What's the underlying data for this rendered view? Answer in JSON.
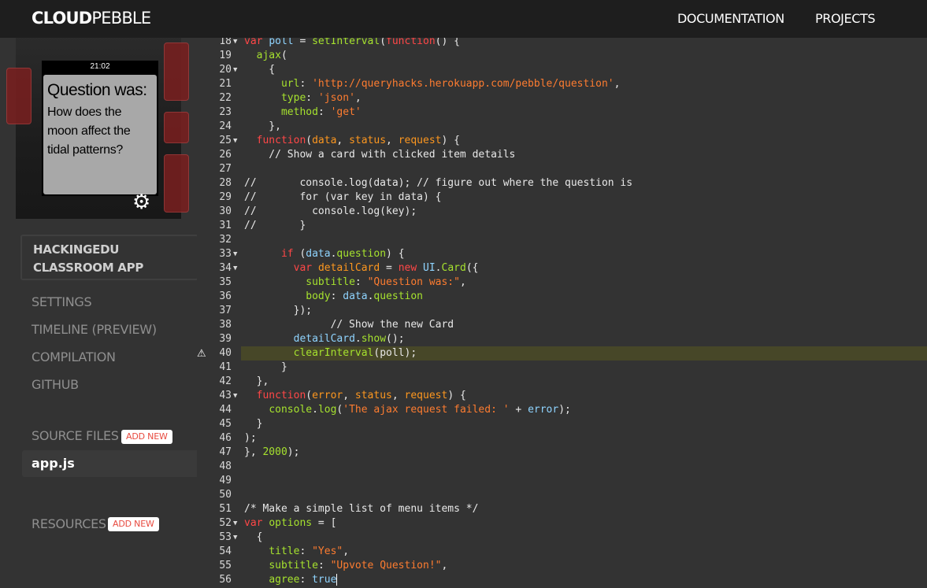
{
  "app": {
    "logo_bold": "CLOUD",
    "logo_rest": "PEBBLE",
    "nav": {
      "documentation": "DOCUMENTATION",
      "projects": "PROJECTS"
    }
  },
  "emulator": {
    "time": "21:02",
    "card_subtitle": "Question was:",
    "card_body": "How does the moon affect the tidal patterns?",
    "gear_icon": "gear-icon"
  },
  "sidebar": {
    "project_name": "HACKINGEDU CLASSROOM APP",
    "items": [
      {
        "label": "SETTINGS"
      },
      {
        "label": "TIMELINE (PREVIEW)"
      },
      {
        "label": "COMPILATION"
      },
      {
        "label": "GITHUB"
      }
    ],
    "source_files_label": "SOURCE FILES",
    "add_new_label": "ADD NEW",
    "files": [
      {
        "name": "app.js"
      }
    ],
    "resources_label": "RESOURCES",
    "resources_add_label": "ADD NEW"
  },
  "editor": {
    "warning_icon": "warning-icon",
    "active_line": 40,
    "lines": [
      {
        "n": "18",
        "fold": true
      },
      {
        "n": "19",
        "fold": false
      },
      {
        "n": "20",
        "fold": true
      },
      {
        "n": "21",
        "fold": false
      },
      {
        "n": "22",
        "fold": false
      },
      {
        "n": "23",
        "fold": false
      },
      {
        "n": "24",
        "fold": false
      },
      {
        "n": "25",
        "fold": true
      },
      {
        "n": "26",
        "fold": false
      },
      {
        "n": "27",
        "fold": false
      },
      {
        "n": "28",
        "fold": false
      },
      {
        "n": "29",
        "fold": false
      },
      {
        "n": "30",
        "fold": false
      },
      {
        "n": "31",
        "fold": false
      },
      {
        "n": "32",
        "fold": false
      },
      {
        "n": "33",
        "fold": true
      },
      {
        "n": "34",
        "fold": true
      },
      {
        "n": "35",
        "fold": false
      },
      {
        "n": "36",
        "fold": false
      },
      {
        "n": "37",
        "fold": false
      },
      {
        "n": "38",
        "fold": false
      },
      {
        "n": "39",
        "fold": false
      },
      {
        "n": "40",
        "fold": false
      },
      {
        "n": "41",
        "fold": false
      },
      {
        "n": "42",
        "fold": false
      },
      {
        "n": "43",
        "fold": true
      },
      {
        "n": "44",
        "fold": false
      },
      {
        "n": "45",
        "fold": false
      },
      {
        "n": "46",
        "fold": false
      },
      {
        "n": "47",
        "fold": false
      },
      {
        "n": "48",
        "fold": false
      },
      {
        "n": "49",
        "fold": false
      },
      {
        "n": "50",
        "fold": false
      },
      {
        "n": "51",
        "fold": false
      },
      {
        "n": "52",
        "fold": true
      },
      {
        "n": "53",
        "fold": true
      },
      {
        "n": "54",
        "fold": false
      },
      {
        "n": "55",
        "fold": false
      },
      {
        "n": "56",
        "fold": false
      }
    ],
    "code": [
      [
        [
          "k",
          "var"
        ],
        [
          "c",
          " "
        ],
        [
          "v",
          "poll"
        ],
        [
          "c",
          " = "
        ],
        [
          "n",
          "setInterval"
        ],
        [
          "c",
          "("
        ],
        [
          "k",
          "function"
        ],
        [
          "c",
          "() {"
        ]
      ],
      [
        [
          "c",
          "  "
        ],
        [
          "n",
          "ajax"
        ],
        [
          "c",
          "("
        ]
      ],
      [
        [
          "c",
          "    {"
        ]
      ],
      [
        [
          "c",
          "      "
        ],
        [
          "g",
          "url"
        ],
        [
          "c",
          ": "
        ],
        [
          "s",
          "'http://queryhacks.herokuapp.com/pebble/question'"
        ],
        [
          "c",
          ","
        ]
      ],
      [
        [
          "c",
          "      "
        ],
        [
          "g",
          "type"
        ],
        [
          "c",
          ": "
        ],
        [
          "s",
          "'json'"
        ],
        [
          "c",
          ","
        ]
      ],
      [
        [
          "c",
          "      "
        ],
        [
          "g",
          "method"
        ],
        [
          "c",
          ": "
        ],
        [
          "s",
          "'get'"
        ]
      ],
      [
        [
          "c",
          "    },"
        ]
      ],
      [
        [
          "c",
          "  "
        ],
        [
          "k",
          "function"
        ],
        [
          "c",
          "("
        ],
        [
          "f",
          "data"
        ],
        [
          "c",
          ", "
        ],
        [
          "f",
          "status"
        ],
        [
          "c",
          ", "
        ],
        [
          "f",
          "request"
        ],
        [
          "c",
          ") {"
        ]
      ],
      [
        [
          "c",
          "    // Show a card with clicked item details"
        ]
      ],
      [
        [
          "c",
          ""
        ]
      ],
      [
        [
          "c",
          "//       console.log(data); // figure out where the question is"
        ]
      ],
      [
        [
          "c",
          "//       for (var key in data) {"
        ]
      ],
      [
        [
          "c",
          "//         console.log(key);"
        ]
      ],
      [
        [
          "c",
          "//       }"
        ]
      ],
      [
        [
          "c",
          ""
        ]
      ],
      [
        [
          "c",
          "      "
        ],
        [
          "k",
          "if"
        ],
        [
          "c",
          " ("
        ],
        [
          "v",
          "data"
        ],
        [
          "c",
          "."
        ],
        [
          "g",
          "question"
        ],
        [
          "c",
          ") {"
        ]
      ],
      [
        [
          "c",
          "        "
        ],
        [
          "k",
          "var"
        ],
        [
          "c",
          " "
        ],
        [
          "f",
          "detailCard"
        ],
        [
          "c",
          " = "
        ],
        [
          "k",
          "new"
        ],
        [
          "c",
          " "
        ],
        [
          "v",
          "UI"
        ],
        [
          "c",
          "."
        ],
        [
          "n",
          "Card"
        ],
        [
          "c",
          "({"
        ]
      ],
      [
        [
          "c",
          "          "
        ],
        [
          "g",
          "subtitle"
        ],
        [
          "c",
          ": "
        ],
        [
          "s",
          "\"Question was:\""
        ],
        [
          "c",
          ","
        ]
      ],
      [
        [
          "c",
          "          "
        ],
        [
          "g",
          "body"
        ],
        [
          "c",
          ": "
        ],
        [
          "v",
          "data"
        ],
        [
          "c",
          "."
        ],
        [
          "g",
          "question"
        ]
      ],
      [
        [
          "c",
          "        });"
        ]
      ],
      [
        [
          "c",
          "              // Show the new Card"
        ]
      ],
      [
        [
          "c",
          "        "
        ],
        [
          "v",
          "detailCard"
        ],
        [
          "c",
          "."
        ],
        [
          "n",
          "show"
        ],
        [
          "c",
          "();"
        ]
      ],
      [
        [
          "c",
          "        "
        ],
        [
          "n",
          "clearInterval"
        ],
        [
          "c",
          "(poll);"
        ]
      ],
      [
        [
          "c",
          "      }"
        ]
      ],
      [
        [
          "c",
          "  },"
        ]
      ],
      [
        [
          "c",
          "  "
        ],
        [
          "k",
          "function"
        ],
        [
          "c",
          "("
        ],
        [
          "f",
          "error"
        ],
        [
          "c",
          ", "
        ],
        [
          "f",
          "status"
        ],
        [
          "c",
          ", "
        ],
        [
          "f",
          "request"
        ],
        [
          "c",
          ") {"
        ]
      ],
      [
        [
          "c",
          "    "
        ],
        [
          "g",
          "console"
        ],
        [
          "c",
          "."
        ],
        [
          "g",
          "log"
        ],
        [
          "c",
          "("
        ],
        [
          "s",
          "'The ajax request failed: '"
        ],
        [
          "c",
          " + "
        ],
        [
          "v",
          "error"
        ],
        [
          "c",
          ");"
        ]
      ],
      [
        [
          "c",
          "  }"
        ]
      ],
      [
        [
          "c",
          ");"
        ]
      ],
      [
        [
          "c",
          "}, "
        ],
        [
          "g",
          "2000"
        ],
        [
          "c",
          ");"
        ]
      ],
      [
        [
          "c",
          ""
        ]
      ],
      [
        [
          "c",
          ""
        ]
      ],
      [
        [
          "c",
          ""
        ]
      ],
      [
        [
          "c",
          "/* Make a simple list of menu items */"
        ]
      ],
      [
        [
          "k",
          "var"
        ],
        [
          "c",
          " "
        ],
        [
          "g",
          "options"
        ],
        [
          "c",
          " = ["
        ]
      ],
      [
        [
          "c",
          "  {"
        ]
      ],
      [
        [
          "c",
          "    "
        ],
        [
          "g",
          "title"
        ],
        [
          "c",
          ": "
        ],
        [
          "s",
          "\"Yes\""
        ],
        [
          "c",
          ","
        ]
      ],
      [
        [
          "c",
          "    "
        ],
        [
          "g",
          "subtitle"
        ],
        [
          "c",
          ": "
        ],
        [
          "s",
          "\"Upvote Question!\""
        ],
        [
          "c",
          ","
        ]
      ],
      [
        [
          "c",
          "    "
        ],
        [
          "g",
          "agree"
        ],
        [
          "c",
          ": "
        ],
        [
          "v",
          "true"
        ]
      ]
    ]
  }
}
